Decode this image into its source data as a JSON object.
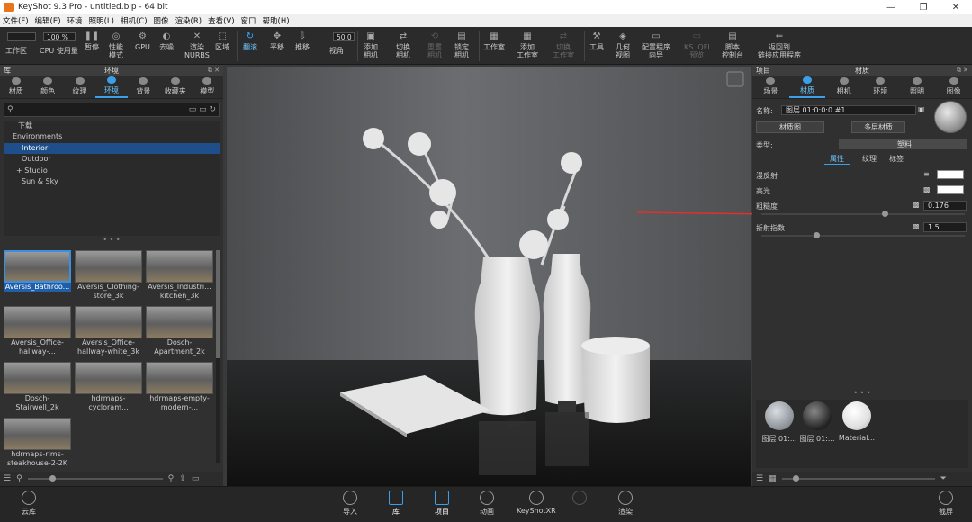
{
  "window": {
    "title": "KeyShot 9.3 Pro - untitled.bip - 64 bit",
    "min": "—",
    "max": "❐",
    "close": "✕"
  },
  "menu": [
    "文件(F)",
    "编辑(E)",
    "环境",
    "照明(L)",
    "相机(C)",
    "图像",
    "渲染(R)",
    "查看(V)",
    "窗口",
    "帮助(H)"
  ],
  "toolbar": {
    "zoom_value": "100 %",
    "fov_value": "50.0",
    "buttons": [
      {
        "label": "工作区",
        "icon": "workspace-icon"
      },
      {
        "label": "CPU 使用量",
        "icon": "cpu-icon"
      },
      {
        "label": "暂停",
        "icon": "pause-icon"
      },
      {
        "label": "性能\n模式",
        "icon": "performance-icon"
      },
      {
        "label": "GPU",
        "icon": "gpu-icon"
      },
      {
        "label": "去噪",
        "icon": "denoise-icon"
      },
      {
        "label": "渲染\nNURBS",
        "icon": "nurbs-icon"
      },
      {
        "label": "区域",
        "icon": "region-icon"
      },
      {
        "label": "翻滚",
        "icon": "tumble-icon"
      },
      {
        "label": "平移",
        "icon": "pan-icon"
      },
      {
        "label": "推移",
        "icon": "dolly-icon"
      },
      {
        "label": "视角",
        "icon": "fov-icon"
      },
      {
        "label": "添加\n相机",
        "icon": "add-camera-icon"
      },
      {
        "label": "切换\n相机",
        "icon": "switch-camera-icon"
      },
      {
        "label": "重置\n相机",
        "icon": "reset-camera-icon"
      },
      {
        "label": "锁定\n相机",
        "icon": "lock-camera-icon"
      },
      {
        "label": "工作室",
        "icon": "studio-icon"
      },
      {
        "label": "添加\n工作室",
        "icon": "add-studio-icon"
      },
      {
        "label": "切换\n工作室",
        "icon": "switch-studio-icon"
      },
      {
        "label": "工具",
        "icon": "tools-icon"
      },
      {
        "label": "几何\n视图",
        "icon": "geometry-view-icon"
      },
      {
        "label": "配置程序\n向导",
        "icon": "configurator-icon"
      },
      {
        "label": "KS  QFI\n预览",
        "icon": "preview-icon"
      },
      {
        "label": "脚本\n控制台",
        "icon": "script-console-icon"
      },
      {
        "label": "返回到\n链接应用程序",
        "icon": "return-link-icon"
      }
    ]
  },
  "library": {
    "panel_left": "库",
    "panel_title": "环境",
    "tabs": [
      "材质",
      "颜色",
      "纹理",
      "环境",
      "背景",
      "收藏夹",
      "模型"
    ],
    "selected_tab": "环境",
    "search_placeholder": "",
    "tree": [
      "下载",
      "Environments",
      "Interior",
      "Outdoor",
      "+ Studio",
      "Sun & Sky"
    ],
    "thumbnails": [
      "Aversis_Bathroo...",
      "Aversis_Clothing-\nstore_3k",
      "Aversis_Industri...\nkitchen_3k",
      "Aversis_Office-\nhallway-...",
      "Aversis_Office-\nhallway-white_3k",
      "Dosch-\nApartment_2k",
      "Dosch-\nStairwell_2k",
      "hdrmaps-\ncycloram...",
      "hdrmaps-empty-\nmodern-...",
      "hdrmaps-rims-\nsteakhouse-2-2K"
    ]
  },
  "project": {
    "panel_left": "项目",
    "panel_title": "材质",
    "tabs": [
      "场景",
      "材质",
      "相机",
      "环境",
      "照明",
      "图像"
    ],
    "selected_tab": "材质",
    "name_label": "名称:",
    "name_value": "图层 01:0:0:0 #1",
    "btn_material_graph": "材质图",
    "btn_multi_material": "多层材质",
    "type_label": "类型:",
    "type_value": "塑料",
    "subtabs": [
      "属性",
      "纹理",
      "标签"
    ],
    "properties": [
      {
        "label": "漫反射",
        "value": ""
      },
      {
        "label": "高光",
        "value": ""
      },
      {
        "label": "粗糙度",
        "value": "0.176",
        "slider": 0.176
      },
      {
        "label": "折射指数",
        "value": "1.5",
        "slider": 0.25
      }
    ],
    "materials": [
      "图层 01:...",
      "图层 01:...",
      "Material..."
    ]
  },
  "statusbar": [
    "云库",
    "导入",
    "库",
    "项目",
    "动画",
    "KeyShotXR",
    "",
    "渲染",
    "截屏"
  ],
  "colors": {
    "accent": "#3ba0e8",
    "arrow": "#e03030",
    "bg": "#303030"
  }
}
